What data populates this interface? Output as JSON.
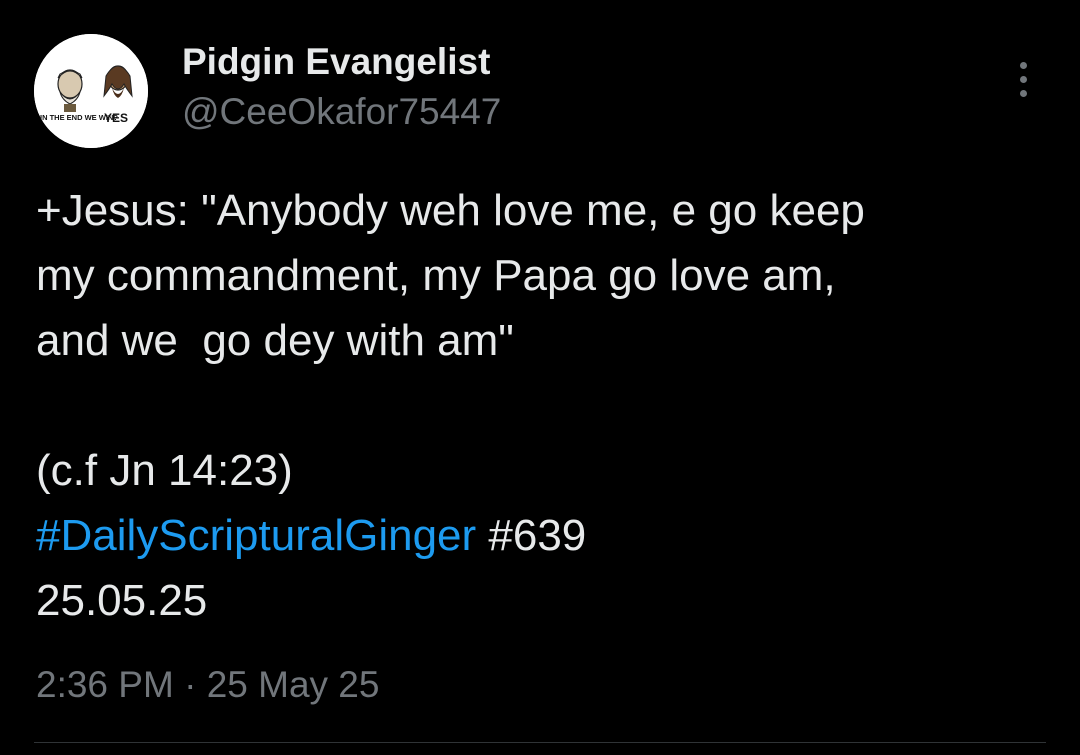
{
  "author": {
    "display_name": "Pidgin Evangelist",
    "handle": "@CeeOkafor75447",
    "avatar_text_left": "IN THE END WE WIN?",
    "avatar_text_right": "YES"
  },
  "tweet": {
    "lines": [
      "+Jesus: \"Anybody weh love me, e go keep",
      "my commandment, my Papa go love am,",
      "and we  go dey with am\""
    ],
    "reference": "(c.f Jn 14:23)",
    "hashtag": "#DailyScripturalGinger",
    "number": " #639",
    "date": "25.05.25"
  },
  "meta": {
    "time": "2:36 PM",
    "separator": " · ",
    "date": "25 May 25"
  },
  "icons": {
    "more": "more-vertical-icon"
  },
  "colors": {
    "background": "#000000",
    "text": "#e7e9ea",
    "secondary": "#71767b",
    "link": "#1d9bf0"
  }
}
